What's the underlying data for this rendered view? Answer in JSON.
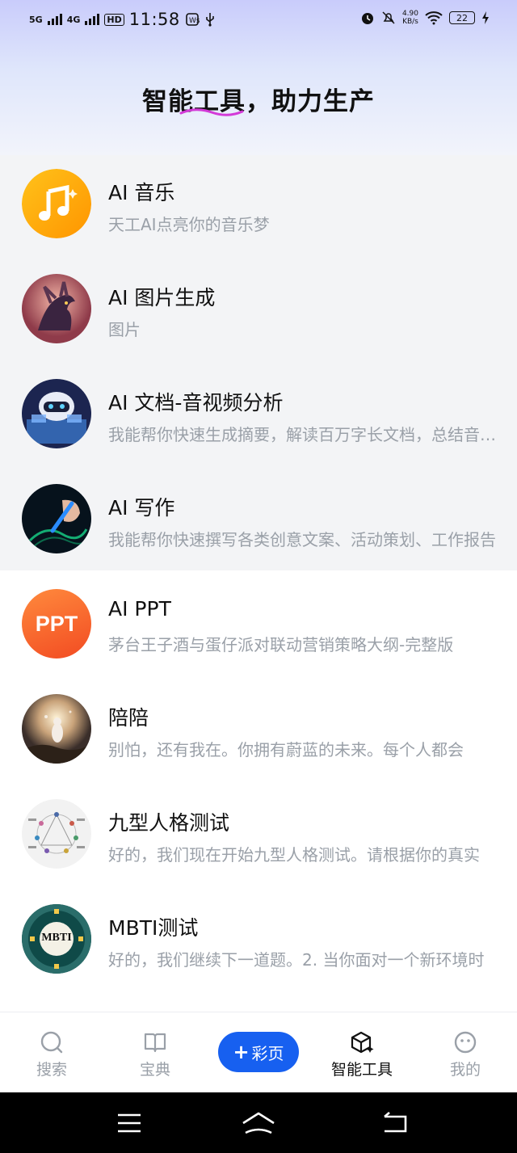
{
  "status_bar": {
    "network1": "5G",
    "network2": "4G",
    "hd": "HD",
    "time": "11:58",
    "speed_value": "4.90",
    "speed_unit": "KB/s",
    "battery": "22"
  },
  "header": {
    "title": "智能工具，助力生产"
  },
  "tools": [
    {
      "name": "AI 音乐",
      "desc": "天工AI点亮你的音乐梦",
      "icon": "music-note-icon"
    },
    {
      "name": "AI 图片生成",
      "desc": "图片",
      "icon": "dragon-image-icon"
    },
    {
      "name": "AI 文档-音视频分析",
      "desc": "我能帮你快速生成摘要，解读百万字长文档，总结音视频内容",
      "icon": "robot-image-icon"
    },
    {
      "name": "AI 写作",
      "desc": "我能帮你快速撰写各类创意文案、活动策划、工作报告",
      "icon": "writing-hand-icon"
    },
    {
      "name": "AI PPT",
      "desc": "茅台王子酒与蛋仔派对联动营销策略大纲-完整版",
      "icon": "ppt-icon",
      "icon_text": "PPT"
    },
    {
      "name": "陪陪",
      "desc": "别怕，还有我在。你拥有蔚蓝的未来。每个人都会",
      "icon": "companion-image-icon"
    },
    {
      "name": "九型人格测试",
      "desc": "好的，我们现在开始九型人格测试。请根据你的真实",
      "icon": "enneagram-icon"
    },
    {
      "name": "MBTI测试",
      "desc": "好的，我们继续下一道题。2. 当你面对一个新环境时",
      "icon": "mbti-icon",
      "icon_text": "MBTI"
    }
  ],
  "tabbar": {
    "search": "搜索",
    "guide": "宝典",
    "create": "彩页",
    "tools": "智能工具",
    "me": "我的"
  },
  "colors": {
    "accent": "#1760f0",
    "muted_text": "#9aa0a8"
  }
}
